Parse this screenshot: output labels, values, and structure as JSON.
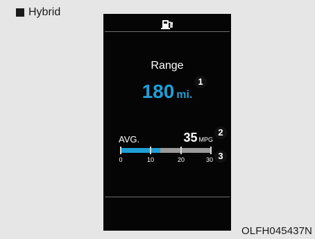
{
  "header": {
    "title": "Hybrid",
    "bullet_icon": "filled-square-icon"
  },
  "display": {
    "fuel_icon": "fuel-pump-icon",
    "range_label": "Range",
    "range_value": "180",
    "range_unit": "mi.",
    "avg_label": "AVG.",
    "avg_value": "35",
    "avg_unit": "MPG",
    "gauge": {
      "ticks": [
        "0",
        "10",
        "20",
        "30"
      ],
      "value": 35,
      "max": 30,
      "fill_fraction": 0.44
    }
  },
  "callouts": [
    "1",
    "2",
    "3"
  ],
  "caption": "OLFH045437N",
  "colors": {
    "background": "#e6e6e6",
    "panel": "#050505",
    "accent": "#1f9fd6",
    "gauge_track": "#9a9a9a"
  }
}
